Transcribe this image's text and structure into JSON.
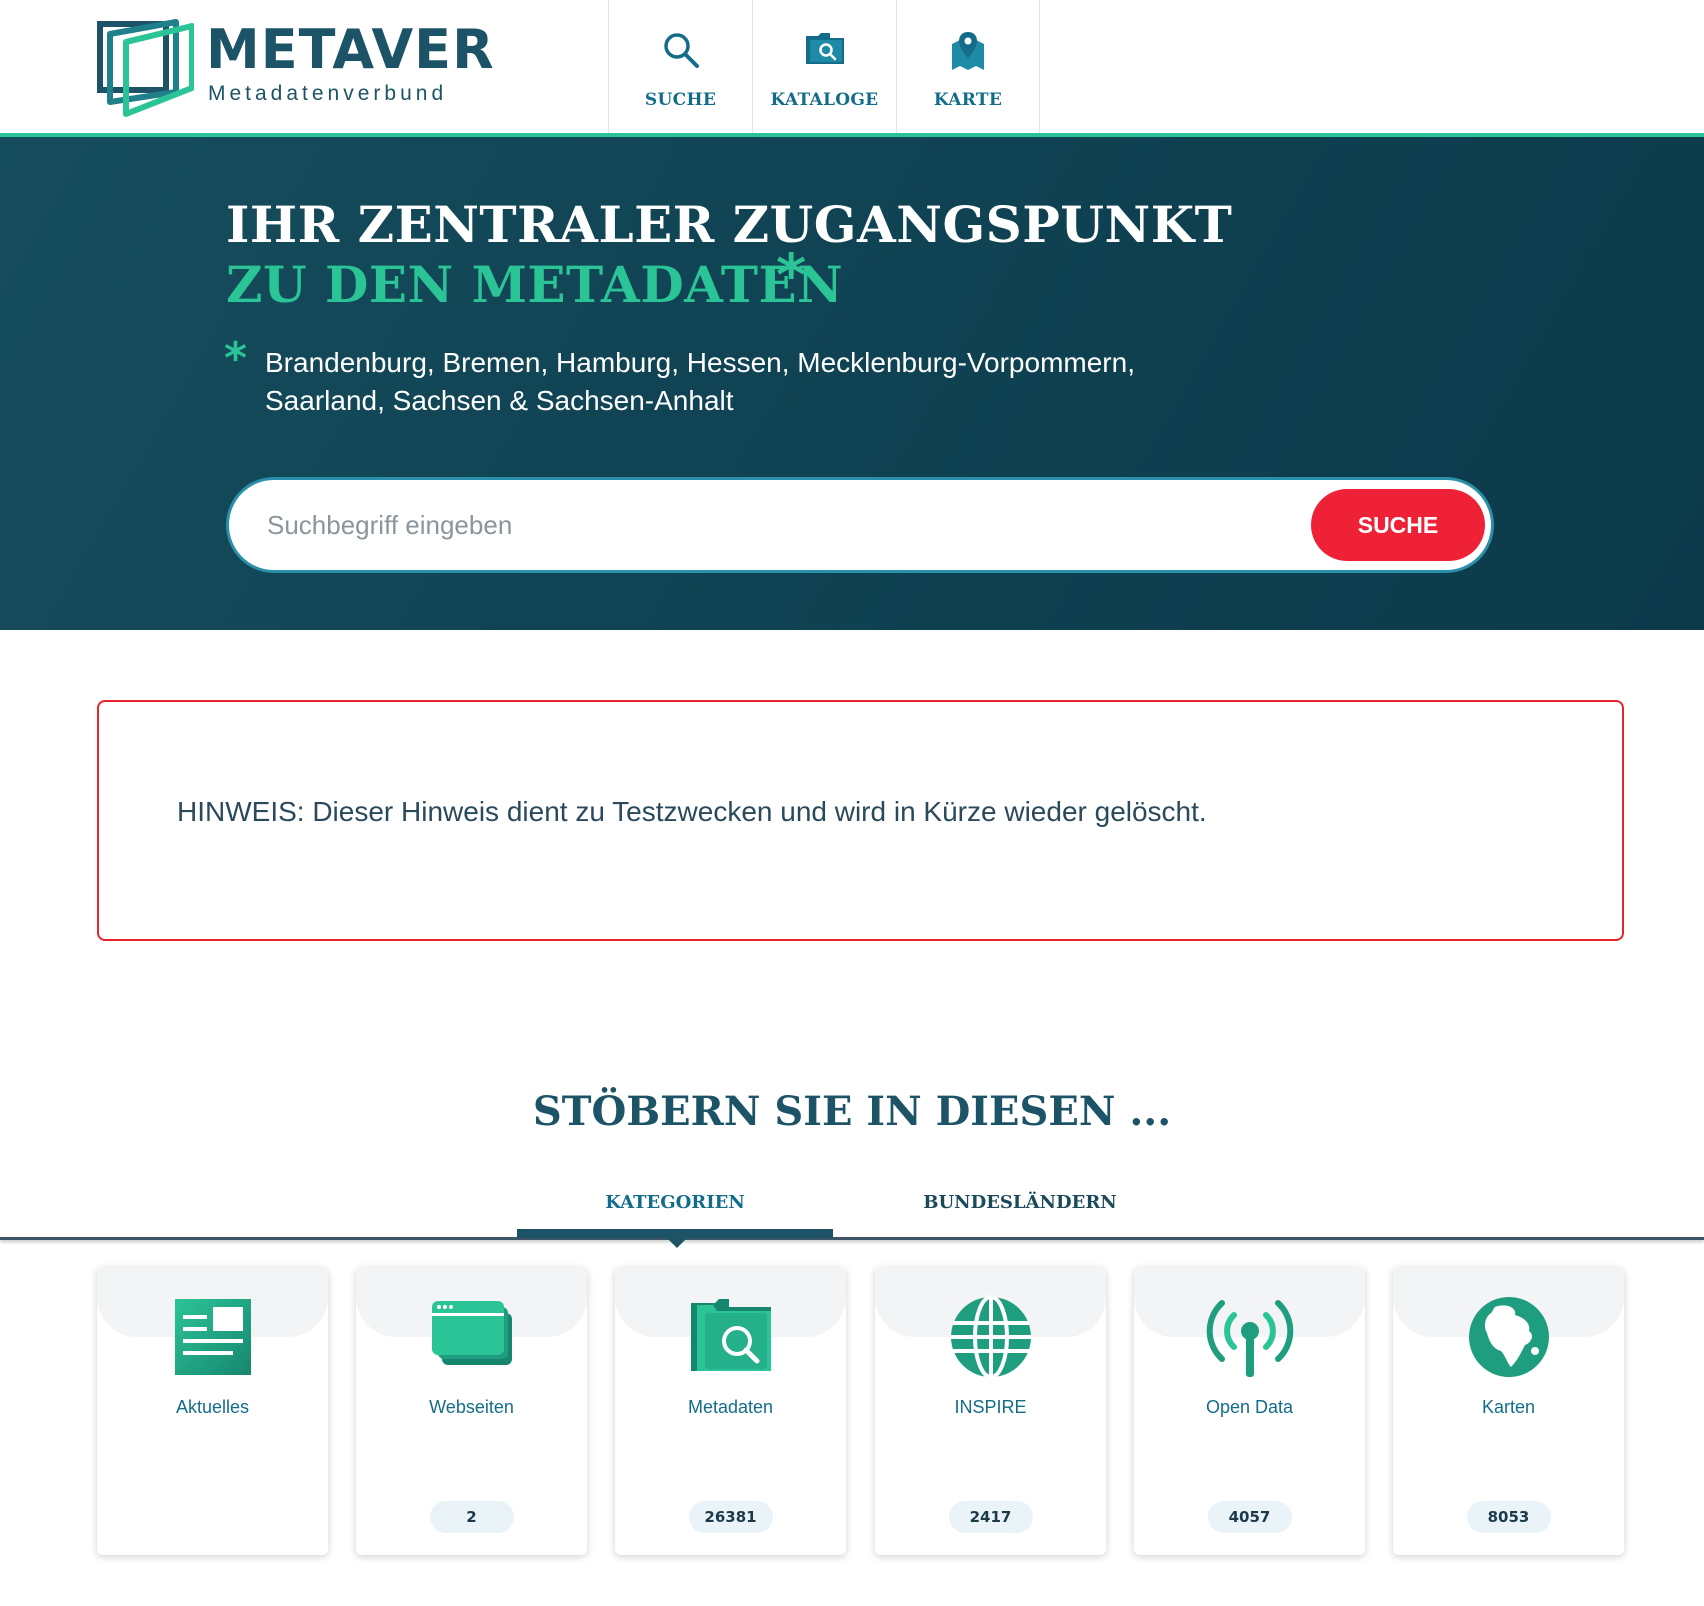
{
  "header": {
    "logo_title": "METAVER",
    "logo_subtitle": "Metadatenverbund",
    "nav": [
      {
        "label": "SUCHE",
        "icon": "search-icon"
      },
      {
        "label": "KATALOGE",
        "icon": "catalog-folder-icon"
      },
      {
        "label": "KARTE",
        "icon": "map-pin-icon"
      }
    ]
  },
  "hero": {
    "title_line1": "IHR ZENTRALER ZUGANGSPUNKT",
    "title_line2": "ZU DEN METADATEN",
    "asterisk": "*",
    "states_line1": "Brandenburg, Bremen, Hamburg, Hessen, Mecklenburg-Vorpommern,",
    "states_line2": "Saarland, Sachsen & Sachsen-Anhalt",
    "search_placeholder": "Suchbegriff eingeben",
    "search_value": "",
    "search_button": "SUCHE"
  },
  "notice": {
    "text": "HINWEIS: Dieser Hinweis dient zu Testzwecken und wird in Kürze wieder gelöscht."
  },
  "browse": {
    "title": "STÖBERN SIE IN DIESEN ...",
    "tabs": [
      {
        "label": "KATEGORIEN",
        "active": true
      },
      {
        "label": "BUNDESLÄNDERN",
        "active": false
      }
    ],
    "cards": [
      {
        "label": "Aktuelles",
        "count": "",
        "icon": "news-icon"
      },
      {
        "label": "Webseiten",
        "count": "2",
        "icon": "browser-windows-icon"
      },
      {
        "label": "Metadaten",
        "count": "26381",
        "icon": "folder-search-icon"
      },
      {
        "label": "INSPIRE",
        "count": "2417",
        "icon": "globe-grid-icon"
      },
      {
        "label": "Open Data",
        "count": "4057",
        "icon": "broadcast-antenna-icon"
      },
      {
        "label": "Karten",
        "count": "8053",
        "icon": "earth-africa-icon"
      }
    ]
  },
  "colors": {
    "brand_dark": "#1d5366",
    "accent_green": "#2bc497",
    "link_teal": "#136d8a",
    "hero_bg": "#0f4252",
    "button_red": "#ee2136",
    "notice_border": "#e5262b"
  }
}
